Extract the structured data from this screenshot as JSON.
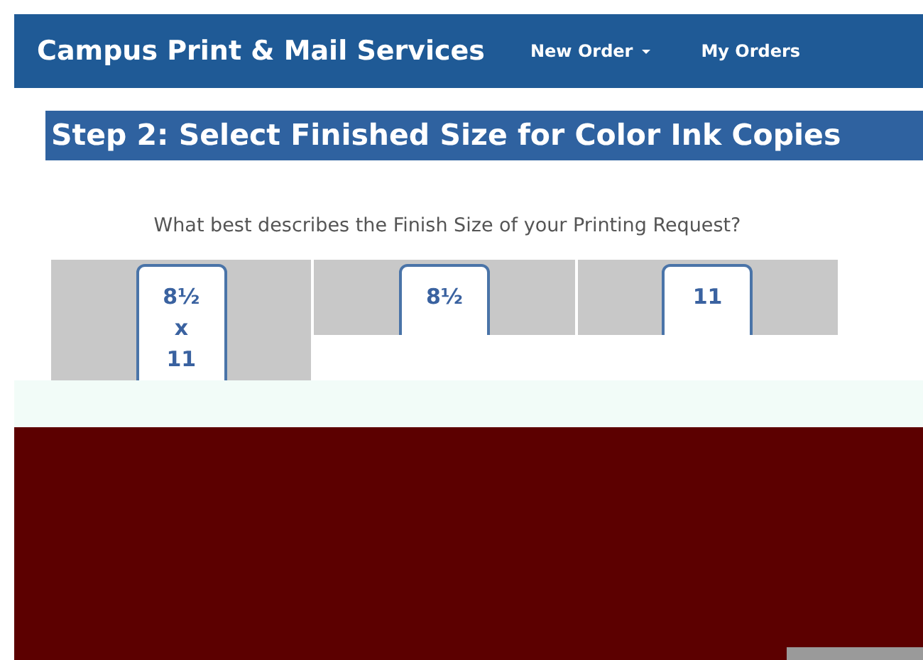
{
  "navbar": {
    "brand": "Campus Print & Mail Services",
    "links": [
      {
        "label": "New Order",
        "dropdown": true
      },
      {
        "label": "My Orders",
        "dropdown": false
      }
    ]
  },
  "step_title": "Step 2: Select Finished Size for Color Ink Copies",
  "question": "What best describes the Finish Size of your Printing Request?",
  "size_options": [
    {
      "lines": [
        "8½",
        "x",
        "11"
      ]
    },
    {
      "lines": [
        "8½"
      ]
    },
    {
      "lines": [
        "11"
      ]
    }
  ]
}
